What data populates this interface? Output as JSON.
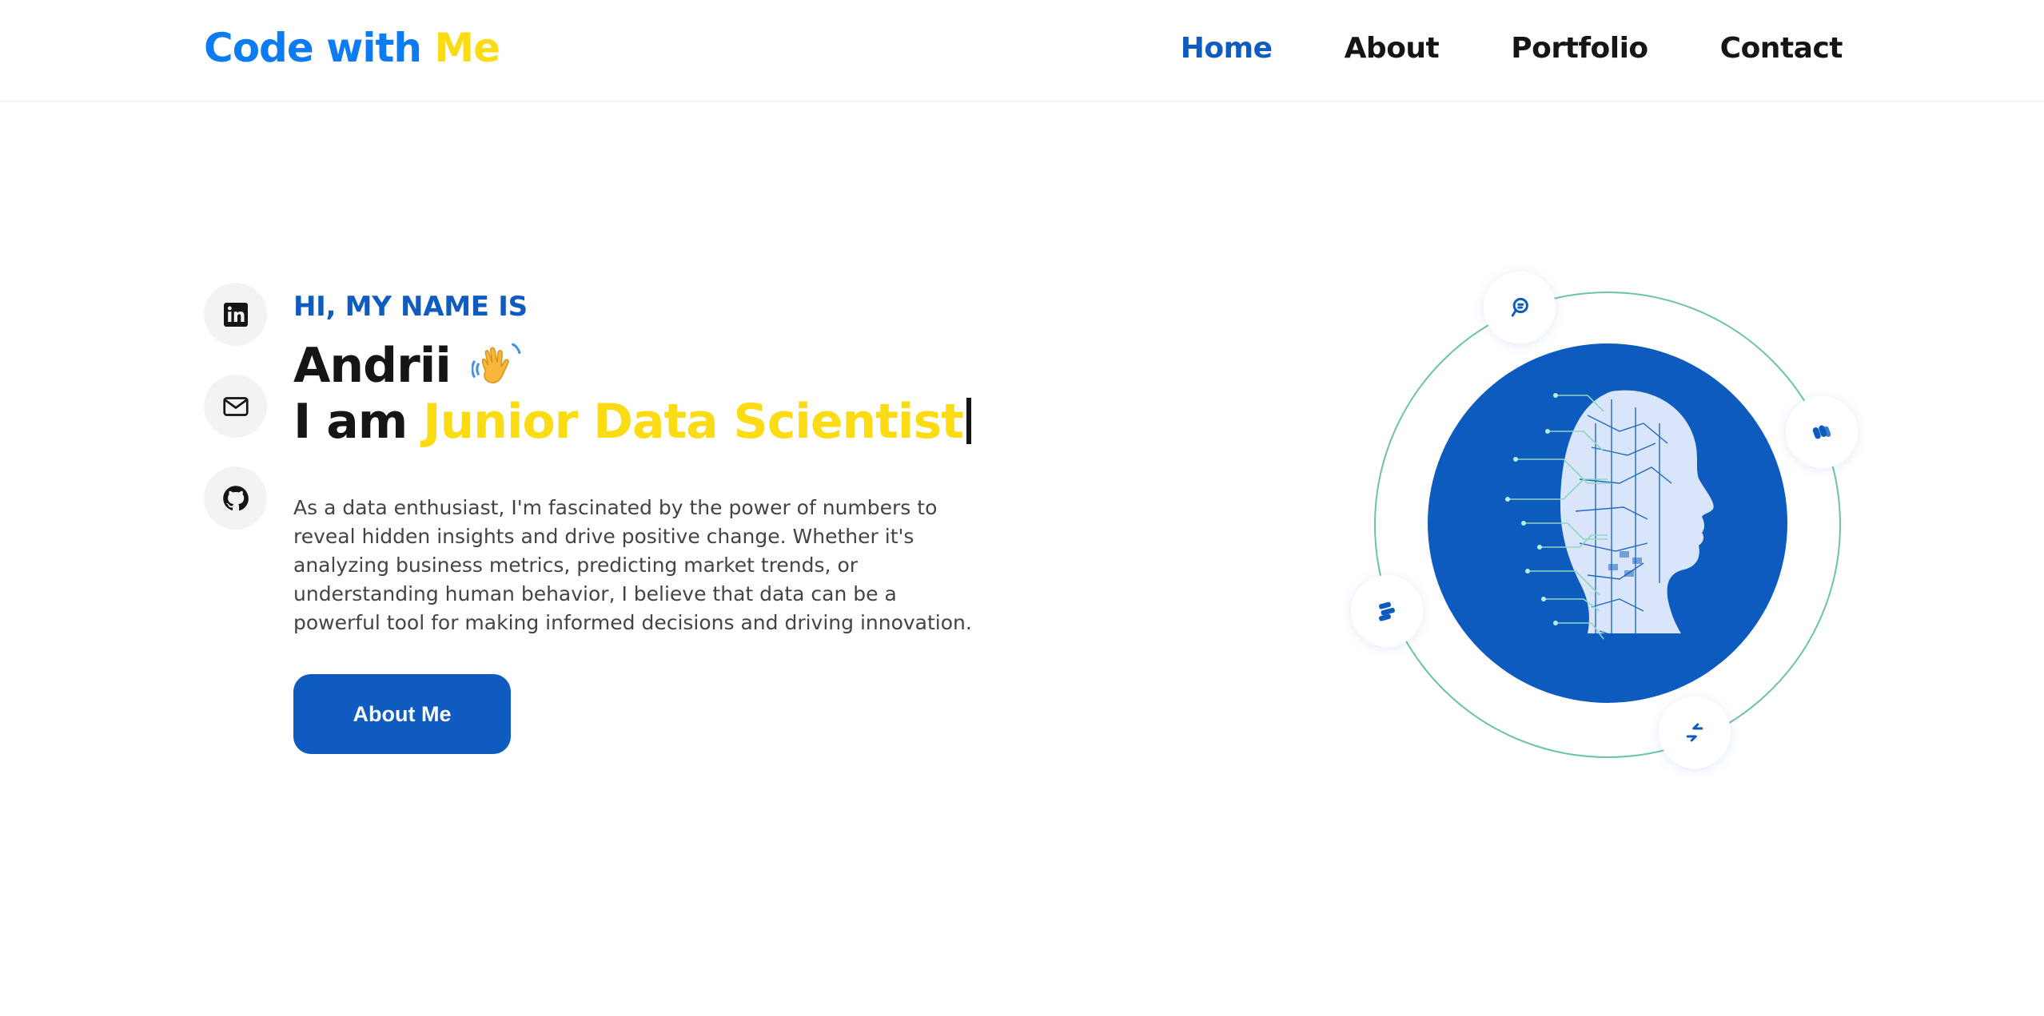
{
  "header": {
    "logo_part1": "Code with",
    "logo_part2": "Me",
    "nav": [
      {
        "label": "Home",
        "active": true
      },
      {
        "label": "About",
        "active": false
      },
      {
        "label": "Portfolio",
        "active": false
      },
      {
        "label": "Contact",
        "active": false
      }
    ]
  },
  "social": [
    "linkedin-icon",
    "mail-icon",
    "github-icon"
  ],
  "hero": {
    "greeting": "HI, MY NAME IS",
    "name": "Andrii",
    "role_prefix": "I am",
    "role": "Junior Data Scientist",
    "description": "As a data enthusiast, I'm fascinated by the power of numbers to reveal hidden insights and drive positive change. Whether it's analyzing business metrics, predicting market trends, or understanding human behavior, I believe that data can be a powerful tool for making informed decisions and driving innovation.",
    "button_label": "About Me"
  },
  "colors": {
    "primary": "#0f5bbf",
    "logo_blue": "#0d7bf2",
    "accent_yellow": "#fadb14",
    "ring": "#6cc3a6"
  }
}
